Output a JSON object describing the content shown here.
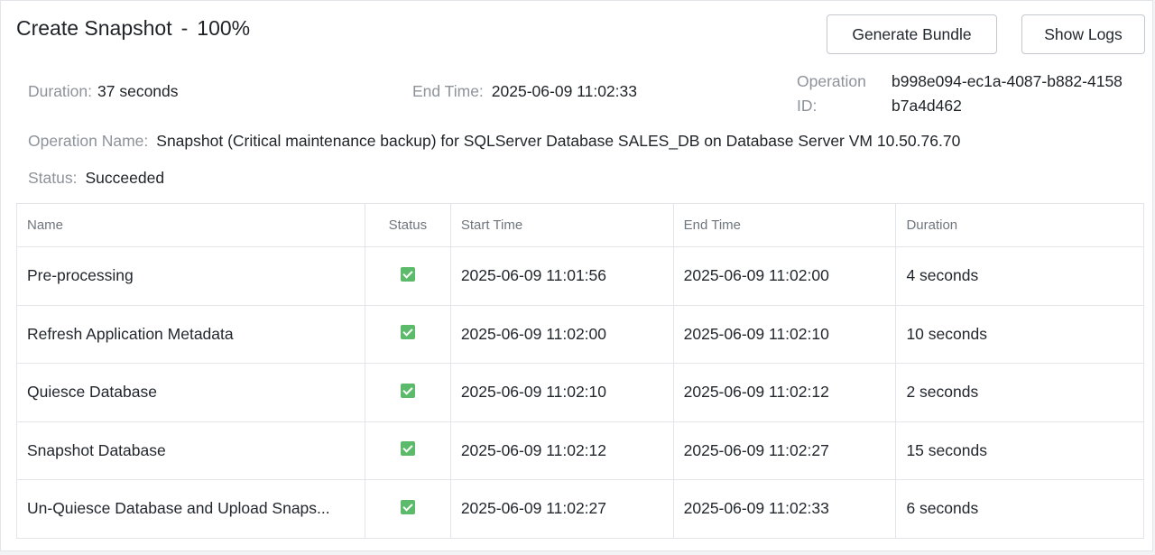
{
  "header": {
    "title": "Create Snapshot",
    "separator": "-",
    "progress": "100%",
    "buttons": {
      "generate_bundle": "Generate Bundle",
      "show_logs": "Show Logs"
    }
  },
  "summary": {
    "duration_label": "Duration:",
    "duration_value": "37 seconds",
    "end_time_label": "End Time:",
    "end_time_value": "2025-06-09 11:02:33",
    "operation_id_label": "Operation ID:",
    "operation_id_value": "b998e094-ec1a-4087-b882-4158b7a4d462",
    "operation_name_label": "Operation Name:",
    "operation_name_value": "Snapshot (Critical maintenance backup) for SQLServer Database SALES_DB on Database Server VM 10.50.76.70",
    "status_label": "Status:",
    "status_value": "Succeeded"
  },
  "table": {
    "columns": {
      "name": "Name",
      "status": "Status",
      "start_time": "Start Time",
      "end_time": "End Time",
      "duration": "Duration"
    },
    "rows": [
      {
        "name": "Pre-processing",
        "status": "succeeded-icon",
        "start_time": "2025-06-09 11:01:56",
        "end_time": "2025-06-09 11:02:00",
        "duration": "4 seconds"
      },
      {
        "name": "Refresh Application Metadata",
        "status": "succeeded-icon",
        "start_time": "2025-06-09 11:02:00",
        "end_time": "2025-06-09 11:02:10",
        "duration": "10 seconds"
      },
      {
        "name": "Quiesce Database",
        "status": "succeeded-icon",
        "start_time": "2025-06-09 11:02:10",
        "end_time": "2025-06-09 11:02:12",
        "duration": "2 seconds"
      },
      {
        "name": "Snapshot Database",
        "status": "succeeded-icon",
        "start_time": "2025-06-09 11:02:12",
        "end_time": "2025-06-09 11:02:27",
        "duration": "15 seconds"
      },
      {
        "name": "Un-Quiesce Database and Upload Snaps...",
        "status": "succeeded-icon",
        "start_time": "2025-06-09 11:02:27",
        "end_time": "2025-06-09 11:02:33",
        "duration": "6 seconds"
      }
    ]
  },
  "colors": {
    "success": "#5cbb6b",
    "label": "#8d939a",
    "border": "#e3e5e8"
  }
}
